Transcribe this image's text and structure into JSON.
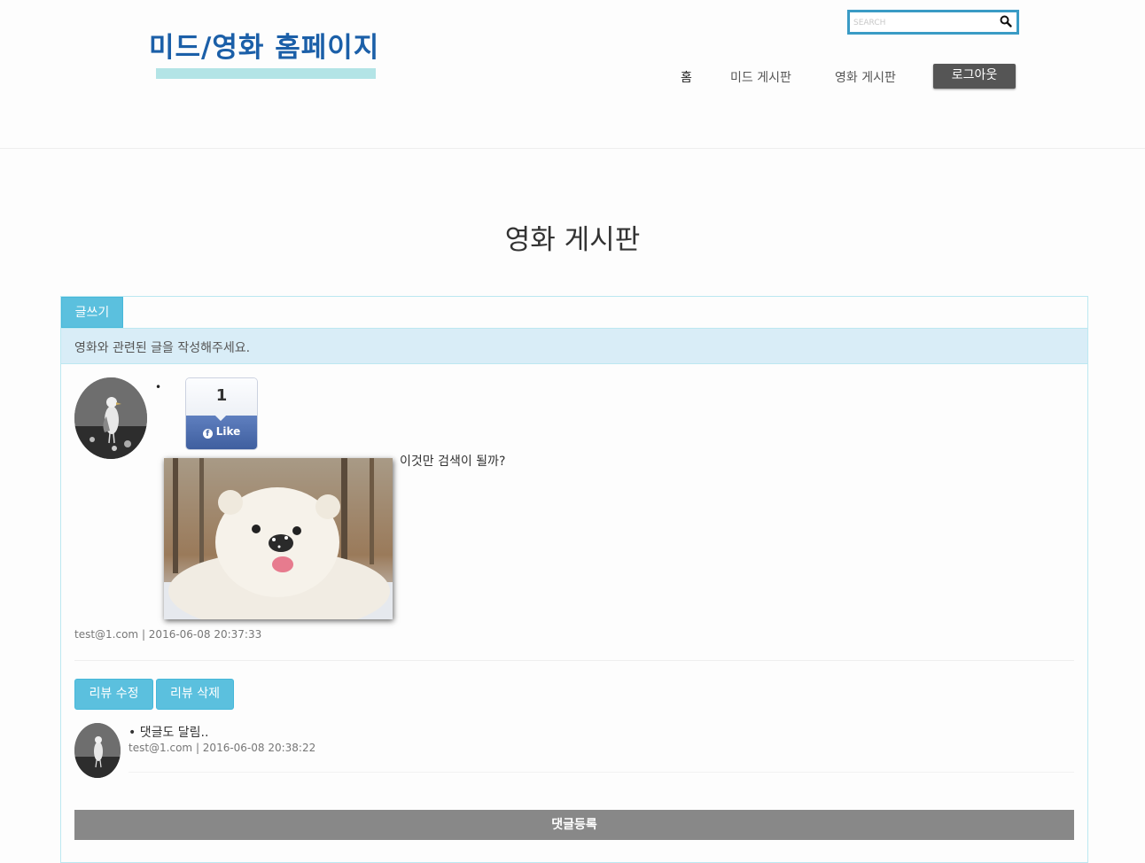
{
  "header": {
    "logo": "미드/영화 홈페이지",
    "search": {
      "placeholder": "SEARCH",
      "icon": "search-icon"
    },
    "nav": {
      "home": "홈",
      "drama_board": "미드 게시판",
      "movie_board": "영화 게시판",
      "logout": "로그아웃"
    }
  },
  "page": {
    "title": "영화 게시판"
  },
  "panel": {
    "write_tab": "글쓰기",
    "info": "영화와 관련된 글을 작성해주세요.",
    "post": {
      "bullet": "•",
      "like_count": "1",
      "like_label": "Like",
      "text": "이것만 검색이 될까?",
      "meta": "test@1.com | 2016-06-08 20:37:33"
    },
    "buttons": {
      "edit": "리뷰 수정",
      "delete": "리뷰 삭제"
    },
    "comment": {
      "text": "• 댓글도 달림..",
      "meta": "test@1.com | 2016-06-08 20:38:22"
    },
    "submit": "댓글등록"
  },
  "colors": {
    "brand": "#1b5fa8",
    "info": "#5bc0de",
    "logout": "#555555",
    "submit": "#888888"
  }
}
